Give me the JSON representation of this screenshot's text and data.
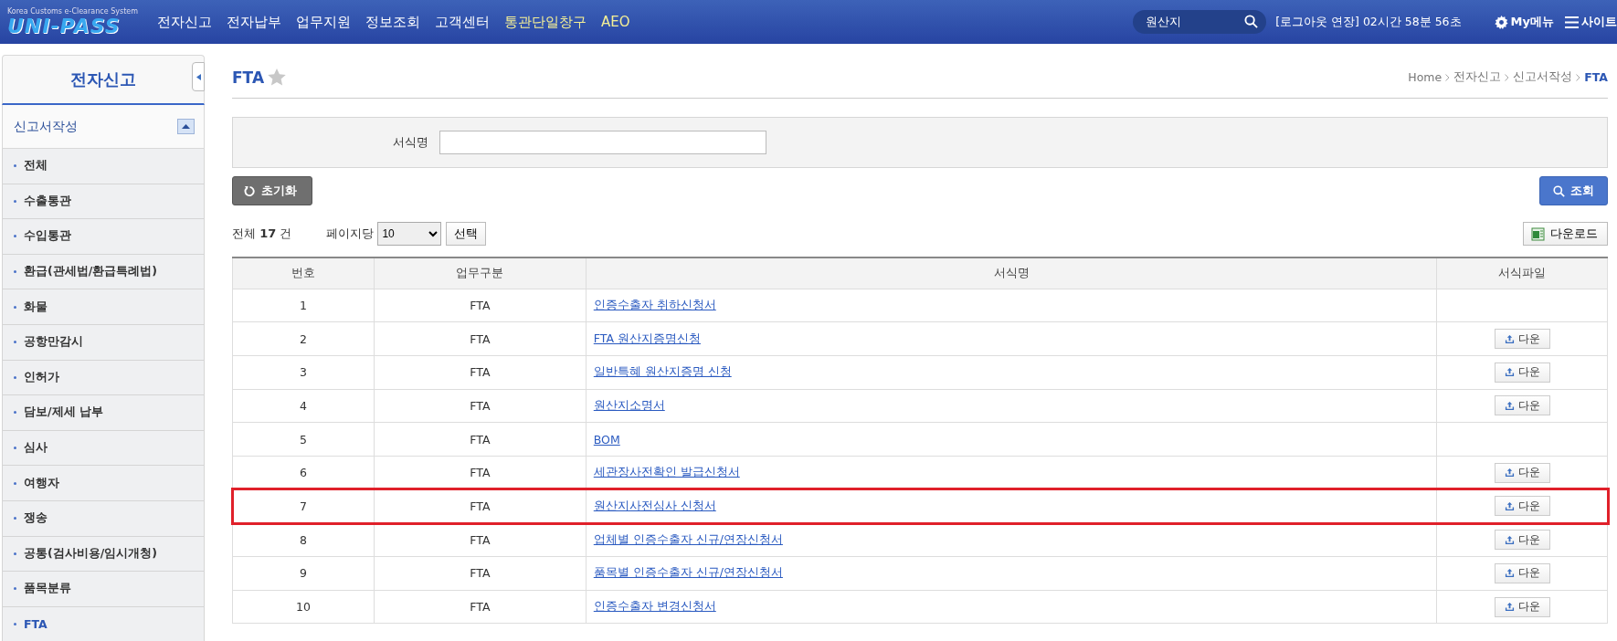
{
  "header": {
    "logo_caption": "Korea Customs e-Clearance System",
    "logo": "UNI-PASS",
    "nav": [
      {
        "label": "전자신고",
        "color": "#ffffff"
      },
      {
        "label": "전자납부",
        "color": "#ffffff"
      },
      {
        "label": "업무지원",
        "color": "#ffffff"
      },
      {
        "label": "정보조회",
        "color": "#ffffff"
      },
      {
        "label": "고객센터",
        "color": "#ffffff"
      },
      {
        "label": "통관단일창구",
        "color": "#f4ef96"
      },
      {
        "label": "AEO",
        "color": "#f4ef96"
      }
    ],
    "search": {
      "value": "원산지"
    },
    "session": "[로그아웃 연장] 02시간 58분 56초",
    "my_menu": "My메뉴",
    "sitemap": "사이트"
  },
  "sidebar": {
    "title": "전자신고",
    "section": {
      "label": "신고서작성",
      "expanded": true
    },
    "items": [
      {
        "label": "전체",
        "selected": false
      },
      {
        "label": "수출통관",
        "selected": false
      },
      {
        "label": "수입통관",
        "selected": false
      },
      {
        "label": "환급(관세법/환급특례법)",
        "selected": false
      },
      {
        "label": "화물",
        "selected": false
      },
      {
        "label": "공항만감시",
        "selected": false
      },
      {
        "label": "인허가",
        "selected": false
      },
      {
        "label": "담보/제세 납부",
        "selected": false
      },
      {
        "label": "심사",
        "selected": false
      },
      {
        "label": "여행자",
        "selected": false
      },
      {
        "label": "쟁송",
        "selected": false
      },
      {
        "label": "공통(검사비용/임시개청)",
        "selected": false
      },
      {
        "label": "품목분류",
        "selected": false
      },
      {
        "label": "FTA",
        "selected": true
      }
    ]
  },
  "page": {
    "title": "FTA",
    "breadcrumb": [
      "Home",
      "전자신고",
      "신고서작성",
      "FTA"
    ]
  },
  "search_form": {
    "label": "서식명"
  },
  "actions": {
    "reset": "초기화",
    "search": "조회"
  },
  "list_bar": {
    "total": "전체 **17** 건",
    "per_page_label": "페이지당",
    "per_page": "10",
    "apply": "선택",
    "download": "다운로드"
  },
  "table": {
    "columns": [
      "번호",
      "업무구분",
      "서식명",
      "서식파일"
    ],
    "rows": [
      {
        "no": "1",
        "type": "FTA",
        "name": "인증수출자 취하신청서",
        "highlighted": false
      },
      {
        "no": "2",
        "type": "FTA",
        "name": "FTA 원산지증명신청",
        "file": "다운",
        "highlighted": false
      },
      {
        "no": "3",
        "type": "FTA",
        "name": "일반특혜 원산지증명 신청",
        "file": "다운",
        "highlighted": false
      },
      {
        "no": "4",
        "type": "FTA",
        "name": "원산지소명서",
        "file": "다운",
        "highlighted": false
      },
      {
        "no": "5",
        "type": "FTA",
        "name": "BOM",
        "highlighted": false
      },
      {
        "no": "6",
        "type": "FTA",
        "name": "세관장사전확인 발급신청서",
        "file": "다운",
        "highlighted": false
      },
      {
        "no": "7",
        "type": "FTA",
        "name": "원산지사전심사 신청서",
        "file": "다운",
        "highlighted": true
      },
      {
        "no": "8",
        "type": "FTA",
        "name": "업체별 인증수출자 신규/연장신청서",
        "file": "다운",
        "highlighted": false
      },
      {
        "no": "9",
        "type": "FTA",
        "name": "품목별 인증수출자 신규/연장신청서",
        "file": "다운",
        "highlighted": false
      },
      {
        "no": "10",
        "type": "FTA",
        "name": "인증수출자 변경신청서",
        "file": "다운",
        "highlighted": false
      }
    ]
  }
}
